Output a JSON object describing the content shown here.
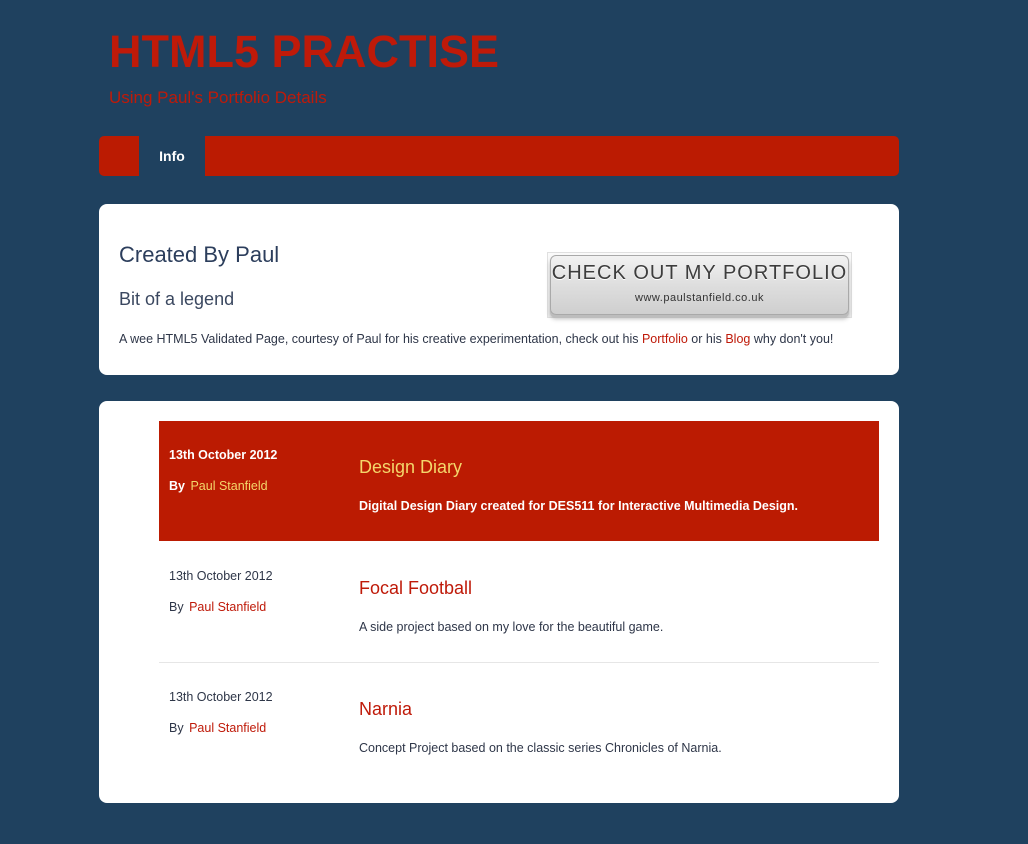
{
  "header": {
    "title": "HTML5 PRACTISE",
    "subtitle": "Using Paul's Portfolio Details"
  },
  "nav": {
    "tabs": [
      {
        "label": "Info"
      }
    ]
  },
  "intro": {
    "heading": "Created By Paul",
    "subheading": "Bit of a legend",
    "text_before": "A wee HTML5 Validated Page, courtesy of Paul for his creative experimentation, check out his ",
    "portfolio_link": "Portfolio",
    "text_middle": " or his ",
    "blog_link": "Blog",
    "text_after": " why don't you!",
    "badge": {
      "title": "CHECK OUT MY PORTFOLIO",
      "url": "www.paulstanfield.co.uk"
    }
  },
  "projects": [
    {
      "date": "13th October 2012",
      "by_label": "By",
      "author": "Paul Stanfield",
      "title": "Design Diary",
      "description": "Digital Design Diary created for DES511 for Interactive Multimedia Design."
    },
    {
      "date": "13th October 2012",
      "by_label": "By",
      "author": "Paul Stanfield",
      "title": "Focal Football",
      "description": "A side project based on my love for the beautiful game."
    },
    {
      "date": "13th October 2012",
      "by_label": "By",
      "author": "Paul Stanfield",
      "title": "Narnia",
      "description": "Concept Project based on the classic series Chronicles of Narnia."
    }
  ],
  "colors": {
    "background": "#1f415f",
    "accent_red": "#bb1b02",
    "highlight_yellow": "#f4d66b",
    "panel": "#ffffff"
  }
}
